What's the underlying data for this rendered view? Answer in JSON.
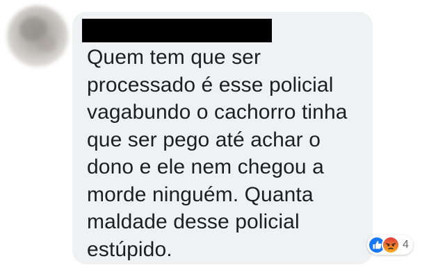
{
  "comment": {
    "author_avatar_icon": "blurred-avatar",
    "author_name_redacted": true,
    "text_lines": [
      "Quem tem que ser",
      "processado é esse policial",
      "vagabundo o cachorro tinha",
      "que ser pego até achar o",
      "dono e ele nem chegou a",
      "morde ninguém.  Quanta",
      "maldade desse policial",
      "estúpido."
    ],
    "reactions": {
      "icons": [
        "like-icon",
        "angry-icon"
      ],
      "count": "4"
    }
  },
  "colors": {
    "bubble_background": "#f0f1f3",
    "text": "#1c1e21",
    "like_blue": "#1877f2",
    "angry_orange": "#f0632a",
    "count_gray": "#65676b"
  }
}
